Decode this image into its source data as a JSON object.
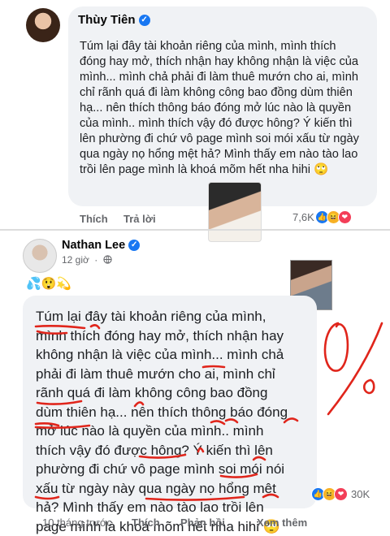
{
  "comment1": {
    "author": "Thùy Tiên",
    "verified_mark": "✓",
    "text": "Túm lại đây tài khoản riêng của mình, mình thích đóng hay mở, thích nhận hay không nhận là việc của mình... mình chả phải đi làm thuê mướn cho ai, mình chỉ rãnh quá đi làm không công bao đồng dùm thiên hạ... nên thích thông báo đóng mở lúc nào là quyền của mình.. mình thích vậy đó được hông? Ý kiến thì lên phường đi chứ vô page mình soi mói xấu từ ngày qua ngày nọ hổng mệt hả? Mình thấy em nào tào lao trồi lên page mình là khoá mõm hết nha hihi 🙄",
    "actions": {
      "like": "Thích",
      "reply": "Trả lời"
    },
    "reaction_count": "7,6K",
    "reaction_icons": [
      "like-reaction-icon",
      "haha-reaction-icon",
      "love-reaction-icon"
    ]
  },
  "post2": {
    "author": "Nathan Lee",
    "verified_mark": "✓",
    "time": "12 giờ",
    "audience_icon": "globe-icon",
    "emojis": "💦😲💫",
    "text_lines": [
      "Túm lại đây tài khoản riêng của mình,",
      "mình thích đóng hay mở, thích nhận hay",
      "không nhận là việc của mình... mình chả",
      "phải đi làm thuê mướn cho ai, mình chỉ",
      "rãnh quá đi làm không công bao đồng",
      "dùm thiên hạ... nên thích thông báo đóng",
      "mở lúc nào là quyền của mình.. mình",
      "thích vậy đó được hông? Ý kiến thì lên",
      "phường đi chứ vô page mình soi mói nói",
      "xấu từ ngày này qua ngày nọ hổng mệt",
      "hả? Mình thấy em nào tào lao trồi lên",
      "page mình là khoá mõm hết nha hihi 🙄"
    ],
    "reaction_count": "30K",
    "actions": {
      "time": "10 tháng trước",
      "like": "Thích",
      "reply": "Phản hồi",
      "more": "Xem thêm"
    }
  },
  "annotation": {
    "percent": "0%",
    "color": "#e0251b"
  },
  "colors": {
    "accent": "#1877f2",
    "bubble": "#f0f2f5",
    "muted": "#65676b"
  }
}
